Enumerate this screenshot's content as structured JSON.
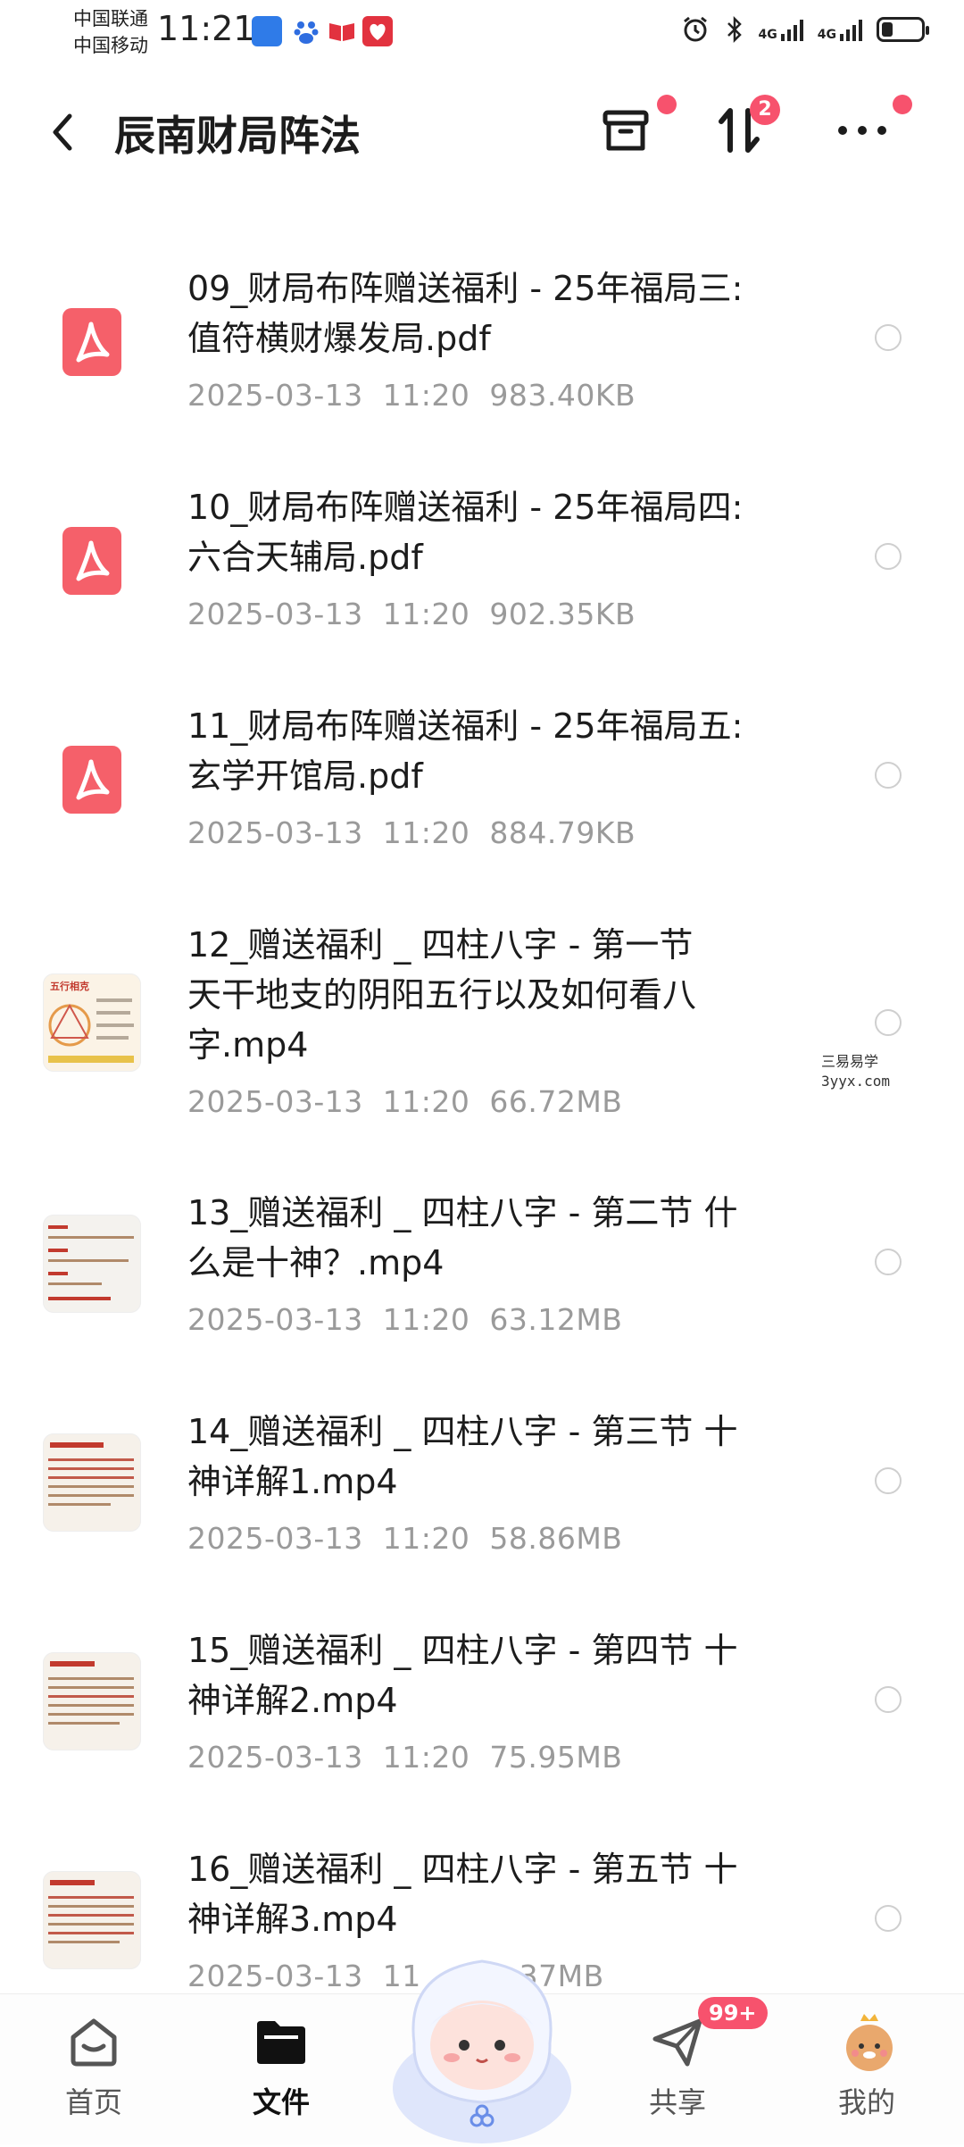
{
  "status_bar": {
    "carrier_1": "中国联通",
    "carrier_2": "中国移动",
    "time": "11:21",
    "network_1": "4G",
    "network_2": "4G"
  },
  "header": {
    "back_icon": "chevron-left-icon",
    "title": "辰南财局阵法",
    "sort_badge": "2"
  },
  "files": [
    {
      "type": "pdf",
      "name_line1": "09_财局布阵赠送福利 - 25年福局三:",
      "name_line2": "值符横财爆发局.pdf",
      "name_line3": "",
      "date": "2025-03-13",
      "time": "11:20",
      "size": "983.40KB"
    },
    {
      "type": "pdf",
      "name_line1": "10_财局布阵赠送福利 - 25年福局四:",
      "name_line2": "六合天辅局.pdf",
      "name_line3": "",
      "date": "2025-03-13",
      "time": "11:20",
      "size": "902.35KB"
    },
    {
      "type": "pdf",
      "name_line1": "11_财局布阵赠送福利 - 25年福局五:",
      "name_line2": "玄学开馆局.pdf",
      "name_line3": "",
      "date": "2025-03-13",
      "time": "11:20",
      "size": "884.79KB"
    },
    {
      "type": "video",
      "name_line1": "12_赠送福利 _ 四柱八字 - 第一节",
      "name_line2": "天干地支的阴阳五行以及如何看八",
      "name_line3": "字.mp4",
      "date": "2025-03-13",
      "time": "11:20",
      "size": "66.72MB"
    },
    {
      "type": "video",
      "name_line1": "13_赠送福利 _ 四柱八字 - 第二节 什",
      "name_line2": "么是十神？.mp4",
      "name_line3": "",
      "date": "2025-03-13",
      "time": "11:20",
      "size": "63.12MB"
    },
    {
      "type": "video",
      "name_line1": "14_赠送福利 _ 四柱八字 - 第三节 十",
      "name_line2": "神详解1.mp4",
      "name_line3": "",
      "date": "2025-03-13",
      "time": "11:20",
      "size": "58.86MB"
    },
    {
      "type": "video",
      "name_line1": "15_赠送福利 _ 四柱八字 - 第四节 十",
      "name_line2": "神详解2.mp4",
      "name_line3": "",
      "date": "2025-03-13",
      "time": "11:20",
      "size": "75.95MB"
    },
    {
      "type": "video",
      "name_line1": "16_赠送福利 _ 四柱八字 - 第五节 十",
      "name_line2": "神详解3.mp4",
      "name_line3": "",
      "date": "2025-03-13",
      "time": "11",
      "size": "37MB"
    }
  ],
  "thumb_text": {
    "t12": "五行相克"
  },
  "watermark": {
    "line1": "三易易学",
    "line2": "3yyx.com"
  },
  "bottom_nav": {
    "home": "首页",
    "files": "文件",
    "share": "共享",
    "share_badge": "99+",
    "mine": "我的"
  },
  "colors": {
    "accent_red": "#f7526d",
    "pdf_red": "#f5606a",
    "meta_gray": "#9a9a9a"
  }
}
